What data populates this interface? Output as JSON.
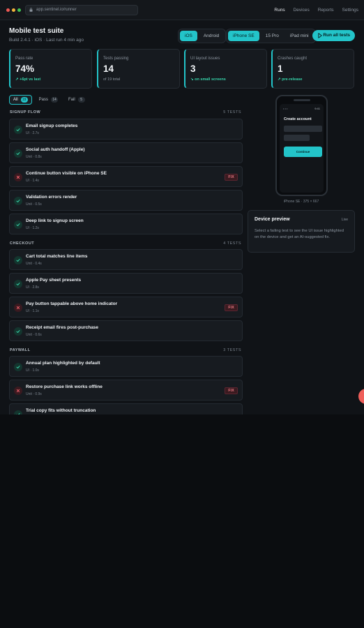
{
  "browser": {
    "url": "app.sentinel.io/runner",
    "nav": [
      {
        "label": "Runs",
        "active": true
      },
      {
        "label": "Devices",
        "active": false
      },
      {
        "label": "Reports",
        "active": false
      },
      {
        "label": "Settings",
        "active": false
      }
    ]
  },
  "header": {
    "title": "Mobile test suite",
    "subtitle": "Build 2.4.1 · iOS · Last run 4 min ago",
    "platforms": [
      {
        "label": "iOS",
        "active": true
      },
      {
        "label": "Android",
        "active": false
      }
    ],
    "devices": [
      {
        "label": "iPhone SE",
        "active": true
      },
      {
        "label": "15 Pro",
        "active": false
      },
      {
        "label": "iPad mini",
        "active": false
      }
    ],
    "run_button": "Run all tests"
  },
  "stats": [
    {
      "label": "Pass rate",
      "value": "74%",
      "note": "↗ +6pt vs last",
      "accent": true
    },
    {
      "label": "Tests passing",
      "value": "14",
      "note": "of 19 total",
      "accent": false
    },
    {
      "label": "UI layout issues",
      "value": "3",
      "note": "↘ on small screens",
      "accent": true
    },
    {
      "label": "Crashes caught",
      "value": "1",
      "note": "↗ pre-release",
      "accent": true
    }
  ],
  "filters": [
    {
      "label": "All",
      "count": "19",
      "active": true
    },
    {
      "label": "Pass",
      "count": "14",
      "active": false
    },
    {
      "label": "Fail",
      "count": "5",
      "active": false
    }
  ],
  "sections": [
    {
      "title": "SIGNUP FLOW",
      "count": "5 TESTS",
      "tests": [
        {
          "name": "Email signup completes",
          "meta": "UI · 2.7s",
          "status": "pass"
        },
        {
          "name": "Social auth handoff (Apple)",
          "meta": "Unit · 0.8s",
          "status": "pass"
        },
        {
          "name": "Continue button visible on iPhone SE",
          "meta": "UI · 1.4s",
          "status": "fail",
          "badge": "FIX"
        },
        {
          "name": "Validation errors render",
          "meta": "Unit · 0.5s",
          "status": "pass"
        },
        {
          "name": "Deep link to signup screen",
          "meta": "UI · 1.2s",
          "status": "pass"
        }
      ]
    },
    {
      "title": "CHECKOUT",
      "count": "4 TESTS",
      "tests": [
        {
          "name": "Cart total matches line items",
          "meta": "Unit · 0.4s",
          "status": "pass"
        },
        {
          "name": "Apple Pay sheet presents",
          "meta": "UI · 2.8s",
          "status": "pass"
        },
        {
          "name": "Pay button tappable above home indicator",
          "meta": "UI · 1.1s",
          "status": "fail",
          "badge": "FIX"
        },
        {
          "name": "Receipt email fires post-purchase",
          "meta": "Unit · 0.6s",
          "status": "pass"
        }
      ]
    },
    {
      "title": "PAYWALL",
      "count": "3 TESTS",
      "tests": [
        {
          "name": "Annual plan highlighted by default",
          "meta": "UI · 1.0s",
          "status": "pass"
        },
        {
          "name": "Restore purchase link works offline",
          "meta": "Unit · 0.9s",
          "status": "fail",
          "badge": "FIX"
        },
        {
          "name": "Trial copy fits without truncation",
          "meta": "",
          "status": "pass"
        }
      ]
    }
  ],
  "phone": {
    "status_left": "• • •",
    "time": "9:41",
    "screen_title": "Create account",
    "button": "Continue",
    "caption": "iPhone SE · 375 × 667"
  },
  "preview": {
    "title": "Device preview",
    "live": "Live",
    "body": "Select a failing test to see the UI issue highlighted on the device and get an AI-suggested fix."
  },
  "colors": {
    "accent": "#23c4c9",
    "pass": "#36d1a8",
    "fail": "#ef5f6a",
    "background": "#0b0d10"
  }
}
